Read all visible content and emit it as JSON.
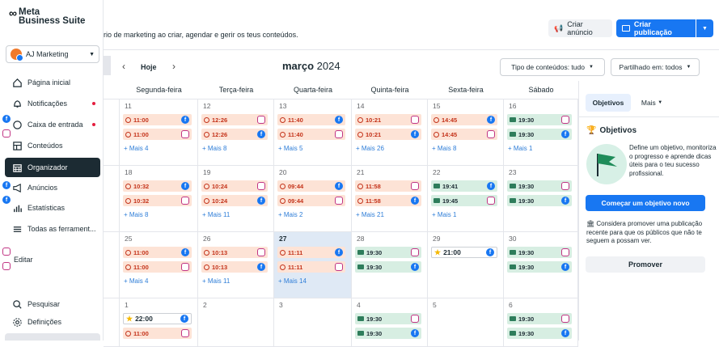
{
  "sidebar": {
    "logo_line1": "Meta",
    "logo_line2": "Business Suite",
    "account": "AJ Marketing",
    "items": [
      {
        "label": "Página inicial"
      },
      {
        "label": "Notificações"
      },
      {
        "label": "Caixa de entrada"
      },
      {
        "label": "Conteúdos"
      },
      {
        "label": "Organizador"
      },
      {
        "label": "Anúncios"
      },
      {
        "label": "Estatísticas"
      },
      {
        "label": "Todas as ferrament..."
      }
    ],
    "edit": "Editar",
    "search": "Pesquisar",
    "settings": "Definições"
  },
  "header": {
    "subtitle": "rio de marketing ao criar, agendar e gerir os teus conteúdos.",
    "create_ad": "Criar anúncio",
    "create_post": "Criar publicação"
  },
  "calendar": {
    "today_btn": "Hoje",
    "month": "março",
    "year": "2024",
    "content_filter": "Tipo de conteúdos: tudo",
    "shared_filter": "Partilhado em: todos",
    "weekdays": [
      "Segunda-feira",
      "Terça-feira",
      "Quarta-feira",
      "Quinta-feira",
      "Sexta-feira",
      "Sábado"
    ],
    "weeks": [
      {
        "days": [
          "11",
          "12",
          "13",
          "14",
          "15",
          "16"
        ],
        "row1": [
          {
            "t": "11:00",
            "k": "o"
          },
          {
            "t": "12:26",
            "k": "o"
          },
          {
            "t": "11:40",
            "k": "o"
          },
          {
            "t": "10:21",
            "k": "o"
          },
          {
            "t": "14:45",
            "k": "o"
          },
          {
            "t": "19:30",
            "k": "g"
          }
        ],
        "row2": [
          {
            "t": "11:00",
            "k": "o"
          },
          {
            "t": "12:26",
            "k": "o"
          },
          {
            "t": "11:40",
            "k": "o"
          },
          {
            "t": "10:21",
            "k": "o"
          },
          {
            "t": "14:45",
            "k": "o"
          },
          {
            "t": "19:30",
            "k": "g"
          }
        ],
        "more": [
          "+ Mais 4",
          "+ Mais 8",
          "+ Mais 5",
          "+ Mais 26",
          "+ Mais 8",
          "+ Mais 1"
        ]
      },
      {
        "days": [
          "18",
          "19",
          "20",
          "21",
          "22",
          "23"
        ],
        "row1": [
          {
            "t": "10:32",
            "k": "o"
          },
          {
            "t": "10:24",
            "k": "o"
          },
          {
            "t": "09:44",
            "k": "o"
          },
          {
            "t": "11:58",
            "k": "o"
          },
          {
            "t": "19:41",
            "k": "g"
          },
          {
            "t": "19:30",
            "k": "g"
          }
        ],
        "row2": [
          {
            "t": "10:32",
            "k": "o"
          },
          {
            "t": "10:24",
            "k": "o"
          },
          {
            "t": "09:44",
            "k": "o"
          },
          {
            "t": "11:58",
            "k": "o"
          },
          {
            "t": "19:45",
            "k": "g"
          },
          {
            "t": "19:30",
            "k": "g"
          }
        ],
        "more": [
          "+ Mais 8",
          "+ Mais 11",
          "+ Mais 2",
          "+ Mais 21",
          "+ Mais 1",
          ""
        ]
      },
      {
        "days": [
          "25",
          "26",
          "27",
          "28",
          "29",
          "30"
        ],
        "row1": [
          {
            "t": "11:00",
            "k": "o"
          },
          {
            "t": "10:13",
            "k": "o"
          },
          {
            "t": "11:11",
            "k": "o"
          },
          {
            "t": "19:30",
            "k": "g"
          },
          {
            "t": "21:00",
            "k": "y"
          },
          {
            "t": "19:30",
            "k": "g"
          }
        ],
        "row2": [
          {
            "t": "11:00",
            "k": "o"
          },
          {
            "t": "10:13",
            "k": "o"
          },
          {
            "t": "11:11",
            "k": "o"
          },
          {
            "t": "19:30",
            "k": "g"
          },
          null,
          {
            "t": "19:30",
            "k": "g"
          }
        ],
        "more": [
          "+ Mais 4",
          "+ Mais 11",
          "+ Mais 14",
          "",
          "",
          ""
        ]
      },
      {
        "days": [
          "1",
          "2",
          "3",
          "4",
          "5",
          "6"
        ],
        "row1": [
          {
            "t": "22:00",
            "k": "y"
          },
          null,
          null,
          {
            "t": "19:30",
            "k": "g"
          },
          null,
          {
            "t": "19:30",
            "k": "g"
          }
        ],
        "row2": [
          {
            "t": "11:00",
            "k": "o"
          },
          null,
          null,
          {
            "t": "19:30",
            "k": "g"
          },
          null,
          {
            "t": "19:30",
            "k": "g"
          }
        ],
        "more": [
          "",
          "",
          "",
          "",
          "",
          ""
        ]
      }
    ]
  },
  "panel": {
    "tab_objectives": "Objetivos",
    "tab_more": "Mais",
    "title": "Objetivos",
    "desc": "Define um objetivo, monitoriza o progresso e aprende dicas úteis para o teu sucesso profissional.",
    "cta": "Começar um objetivo novo",
    "promo": "Considera promover uma publicação recente para que os públicos que não te seguem a possam ver.",
    "promote_btn": "Promover"
  }
}
